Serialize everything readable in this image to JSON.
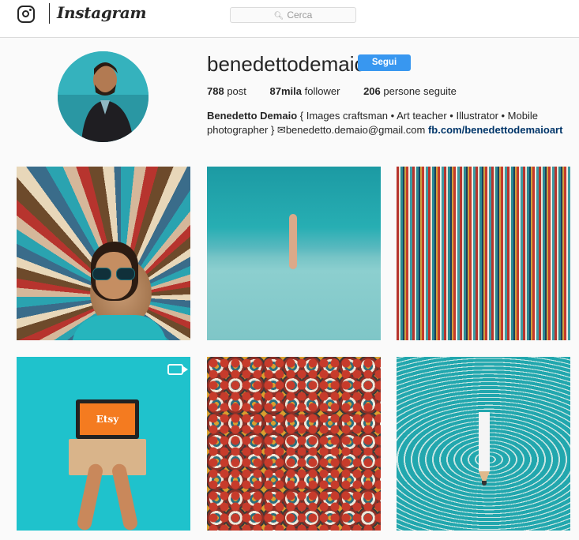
{
  "header": {
    "logo_text": "Instagram",
    "search": {
      "placeholder": "Cerca",
      "icon": "search-icon"
    }
  },
  "profile": {
    "username": "benedettodemaio",
    "follow_label": "Segui",
    "accent_color": "#3897f0",
    "stats": {
      "posts_value": "788",
      "posts_label": "post",
      "followers_value": "87mila",
      "followers_label": "follower",
      "following_value": "206",
      "following_label": "persone seguite"
    },
    "bio": {
      "name": "Benedetto Demaio",
      "text": "{ Images craftsman • Art teacher • Illustrator • Mobile photographer }",
      "email": "✉benedetto.demaio@gmail.com",
      "link": "fb.com/benedettodemaioart"
    }
  },
  "posts": [
    {
      "icon": ""
    },
    {
      "icon": ""
    },
    {
      "icon": ""
    },
    {
      "icon": "video-icon",
      "screen_text": "Etsy"
    },
    {
      "icon": ""
    },
    {
      "icon": ""
    }
  ]
}
